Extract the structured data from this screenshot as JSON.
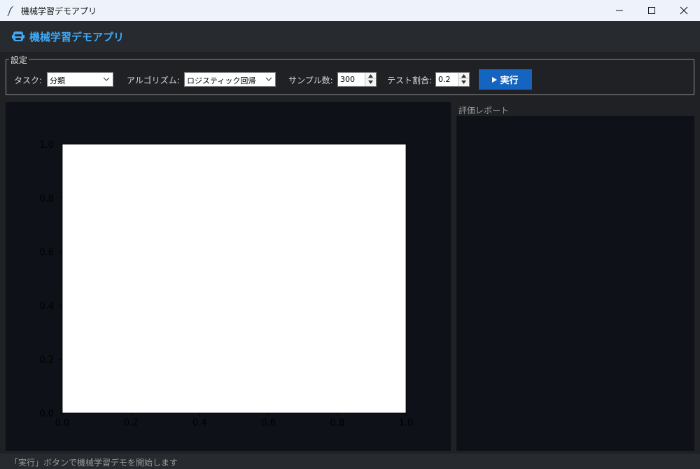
{
  "window": {
    "title": "機械学習デモアプリ"
  },
  "header": {
    "title": "機械学習デモアプリ"
  },
  "settings": {
    "legend": "設定",
    "task_label": "タスク:",
    "task_value": "分類",
    "algorithm_label": "アルゴリズム:",
    "algorithm_value": "ロジスティック回帰",
    "samples_label": "サンプル数:",
    "samples_value": "300",
    "test_ratio_label": "テスト割合:",
    "test_ratio_value": "0.2",
    "run_label": "実行"
  },
  "report": {
    "label": "評価レポート",
    "content": ""
  },
  "status": {
    "text": "「実行」ボタンで機械学習デモを開始します"
  },
  "colors": {
    "accent": "#1565c0",
    "heading": "#3fa9f5",
    "plot_bg": "#0e1117",
    "app_bg": "#202124"
  },
  "icons": {
    "app": "feather-icon",
    "header": "robot-icon",
    "run": "play-icon"
  },
  "chart_data": {
    "type": "scatter",
    "title": "",
    "xlabel": "",
    "ylabel": "",
    "xlim": [
      0.0,
      1.0
    ],
    "ylim": [
      0.0,
      1.0
    ],
    "x_ticks": [
      "0.0",
      "0.2",
      "0.4",
      "0.6",
      "0.8",
      "1.0"
    ],
    "y_ticks": [
      "0.0",
      "0.2",
      "0.4",
      "0.6",
      "0.8",
      "1.0"
    ],
    "series": [],
    "grid": false
  }
}
